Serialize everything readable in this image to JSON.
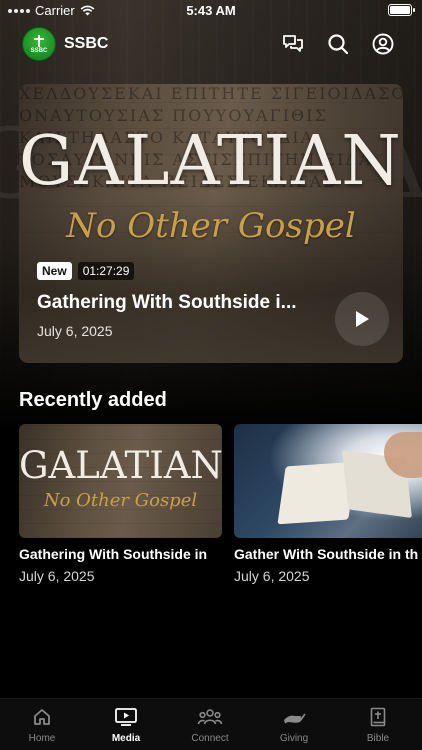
{
  "status_bar": {
    "carrier": "Carrier",
    "time": "5:43 AM"
  },
  "header": {
    "logo_text": "SSBC",
    "title": "SSBC",
    "icons": [
      "chat-icon",
      "search-icon",
      "profile-icon"
    ]
  },
  "hero": {
    "art_title": "GALATIANS",
    "art_subtitle": "No Other Gospel",
    "badge": "New",
    "duration": "01:27:29",
    "title": "Gathering With Southside i...",
    "date": "July 6, 2025"
  },
  "recently_added": {
    "heading": "Recently added",
    "items": [
      {
        "art_title": "GALATIANS",
        "art_subtitle": "No Other Gospel",
        "title": "Gathering With Southside in",
        "date": "July 6, 2025"
      },
      {
        "title": "Gather With Southside in th",
        "date": "July 6, 2025"
      }
    ]
  },
  "tabs": [
    {
      "label": "Home",
      "icon": "home-icon"
    },
    {
      "label": "Media",
      "icon": "media-icon",
      "active": true
    },
    {
      "label": "Connect",
      "icon": "people-icon"
    },
    {
      "label": "Giving",
      "icon": "giving-hand-icon"
    },
    {
      "label": "Bible",
      "icon": "bible-icon"
    }
  ],
  "colors": {
    "accent_gold": "#c9a04a",
    "logo_green": "#1f9a2a",
    "background": "#000000"
  }
}
